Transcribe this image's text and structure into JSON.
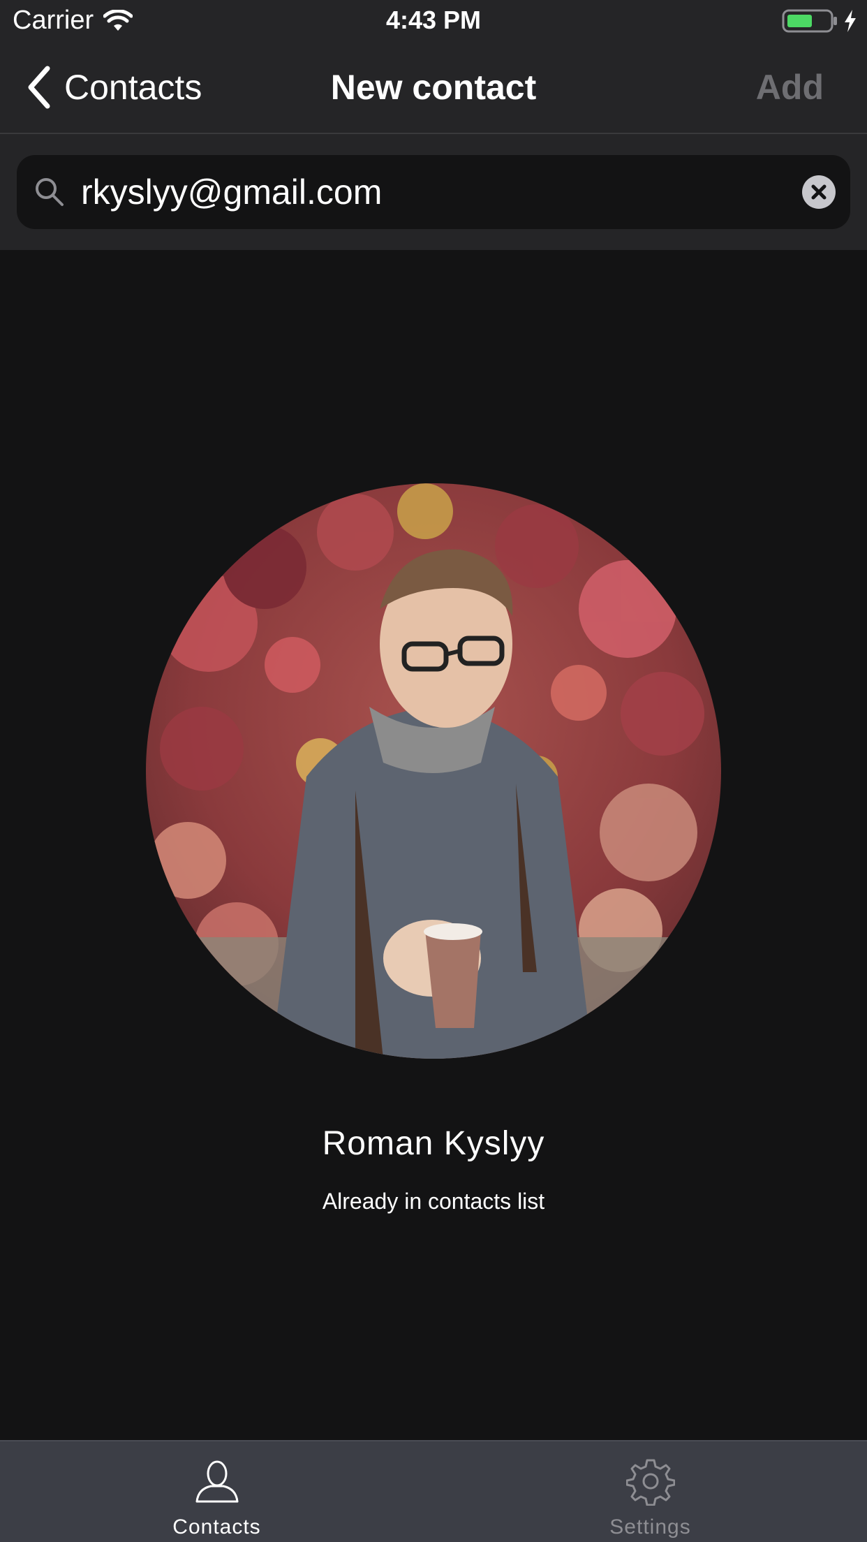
{
  "status_bar": {
    "carrier": "Carrier",
    "time": "4:43 PM",
    "battery_color": "#4cd964"
  },
  "nav": {
    "back_label": "Contacts",
    "title": "New contact",
    "add_label": "Add",
    "add_color": "#6e6e72"
  },
  "search": {
    "value": "rkyslyy@gmail.com",
    "placeholder": ""
  },
  "contact": {
    "name": "Roman Kyslyy",
    "status": "Already in contacts list"
  },
  "tabs": [
    {
      "label": "Contacts",
      "icon": "person-icon",
      "selected": true
    },
    {
      "label": "Settings",
      "icon": "gear-icon",
      "selected": false
    }
  ]
}
